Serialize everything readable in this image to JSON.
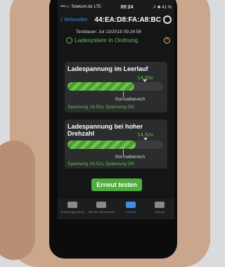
{
  "status_bar": {
    "carrier": "•••○○ Telekom.de  LTE",
    "time": "09:24",
    "right": "↗ ✱ 41 %"
  },
  "nav": {
    "back_label": "⟨ Verbunden",
    "device_mac": "44:EA:D8:FA:A8:BC",
    "settings_icon": "gear-icon"
  },
  "test": {
    "duration_label": "Testdauer:  Jul 13/2018 09:24:56",
    "status_text": "Ladesystem in Ordnung",
    "help_symbol": "?"
  },
  "cards": [
    {
      "title": "Ladespannung im Leerlauf",
      "value": "14.50v",
      "fill": 0.7,
      "normal_label": "Normalbereich",
      "footer": "Spannung 14.50v, Spannung OK"
    },
    {
      "title": "Ladespannung bei hoher Drehzahl",
      "value": "14.52v",
      "fill": 0.71,
      "normal_label": "Normalbereich",
      "footer": "Spannung 14.52v, Spannung OK"
    }
  ],
  "retest_button": "Erneut testen",
  "tabs": [
    {
      "label": "Spannungsprüfung",
      "icon": "battery-icon",
      "active": false
    },
    {
      "label": "Test der Startsystems",
      "icon": "motorcycle-icon",
      "active": false
    },
    {
      "label": "Ladetest",
      "icon": "plug-icon",
      "active": true
    },
    {
      "label": "Historie",
      "icon": "chart-icon",
      "active": false
    }
  ],
  "colors": {
    "accent_green": "#63c24f",
    "accent_blue": "#3d8fe0",
    "background": "#141516"
  }
}
